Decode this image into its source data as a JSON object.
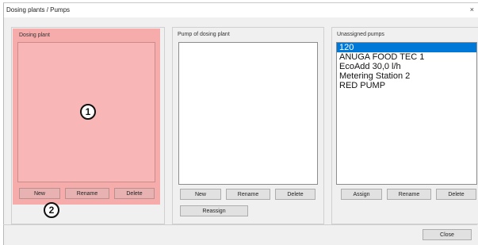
{
  "window": {
    "title": "Dosing plants / Pumps",
    "close_symbol": "×"
  },
  "dosing_plant": {
    "title": "Dosing plant",
    "buttons": {
      "new": "New",
      "rename": "Rename",
      "delete": "Delete"
    }
  },
  "pump_of_dosing_plant": {
    "title": "Pump of dosing plant",
    "buttons": {
      "new": "New",
      "rename": "Rename",
      "delete": "Delete",
      "reassign": "Reassign"
    }
  },
  "unassigned_pumps": {
    "title": "Unassigned pumps",
    "items": [
      "120",
      "ANUGA FOOD TEC 1",
      "EcoAdd 30,0 l/h",
      "Metering Station 2",
      "RED PUMP"
    ],
    "selected_index": 0,
    "buttons": {
      "assign": "Assign",
      "rename": "Rename",
      "delete": "Delete"
    }
  },
  "footer": {
    "close": "Close"
  },
  "callouts": [
    "1",
    "2"
  ],
  "colors": {
    "highlight": "#f8a0a0",
    "selection": "#0078d7"
  }
}
